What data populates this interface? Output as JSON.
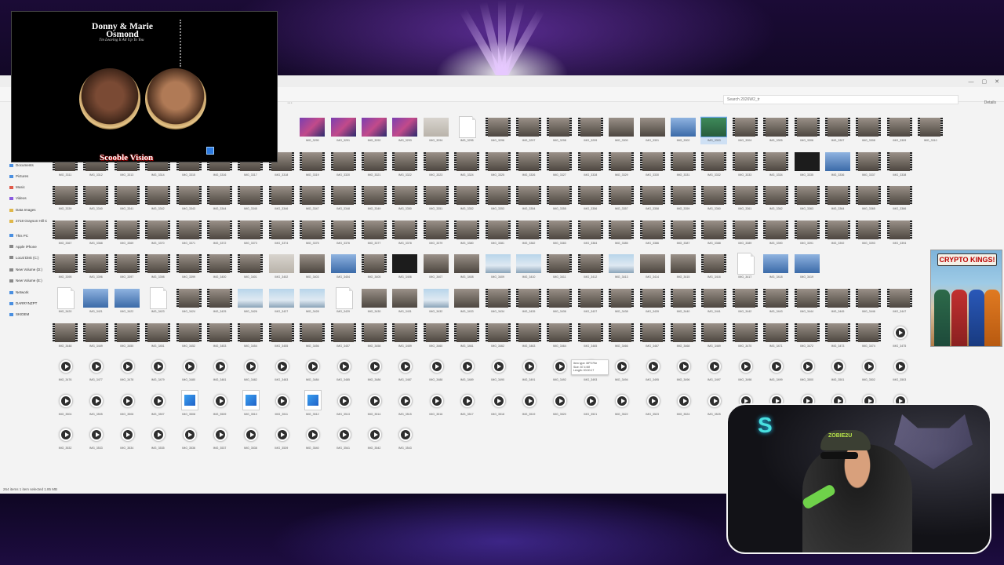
{
  "explorer": {
    "search_placeholder": "Search 2026W2_tr",
    "window_controls": [
      "—",
      "▢",
      "✕"
    ],
    "more_label": "···",
    "details_label": "Details",
    "status_text": "264 items    1 item selected  1.85 MB",
    "sidebar": [
      {
        "label": "Documents",
        "color": "#4a8fe0"
      },
      {
        "label": "Pictures",
        "color": "#4a8fe0"
      },
      {
        "label": "Music",
        "color": "#e05a4a"
      },
      {
        "label": "Videos",
        "color": "#8a5ae0"
      },
      {
        "label": "Data Images",
        "color": "#e0b84a"
      },
      {
        "label": "2718 Grayson Hill C",
        "color": "#e0b84a"
      },
      {
        "label": "This PC",
        "color": "#4a8fe0"
      },
      {
        "label": "Apple iPhone",
        "color": "#888888"
      },
      {
        "label": "Local Disk (C:)",
        "color": "#888888"
      },
      {
        "label": "New Volume (D:)",
        "color": "#888888"
      },
      {
        "label": "New Volume (E:)",
        "color": "#888888"
      },
      {
        "label": "Network",
        "color": "#4a8fe0"
      },
      {
        "label": "DARRYNZPT",
        "color": "#4a8fe0"
      },
      {
        "label": "SKIDEM",
        "color": "#4a8fe0"
      }
    ]
  },
  "tooltip": {
    "line1": "Item type: MP3 File",
    "line2": "Size: 87.4 MB",
    "line3": "Length: 00:00:17"
  },
  "grid": {
    "selected": "IMG_3303",
    "rows": [
      {
        "start": 8,
        "kinds": [
          "pc",
          "pc",
          "pc",
          "pc",
          "light",
          "doc",
          "film",
          "film",
          "film",
          "film",
          "room",
          "room",
          "blue",
          "green",
          "film",
          "film",
          "film",
          "film",
          "film",
          "film",
          "film"
        ]
      },
      {
        "start": 0,
        "kinds": [
          "film",
          "film",
          "film",
          "film",
          "film",
          "film",
          "film",
          "film",
          "film",
          "film",
          "film",
          "film",
          "film",
          "film",
          "film",
          "film",
          "film",
          "film",
          "film",
          "film",
          "film",
          "film",
          "film",
          "film",
          "dark",
          "blue",
          "film",
          "film"
        ]
      },
      {
        "start": 0,
        "kinds": [
          "film",
          "film",
          "film",
          "film",
          "film",
          "film",
          "film",
          "film",
          "film",
          "film",
          "film",
          "film",
          "film",
          "film",
          "film",
          "film",
          "film",
          "film",
          "film",
          "film",
          "film",
          "film",
          "film",
          "film",
          "film",
          "film",
          "film",
          "film"
        ]
      },
      {
        "start": 0,
        "kinds": [
          "film",
          "film",
          "film",
          "film",
          "film",
          "film",
          "film",
          "film",
          "film",
          "film",
          "film",
          "film",
          "film",
          "film",
          "film",
          "film",
          "film",
          "film",
          "film",
          "film",
          "film",
          "film",
          "film",
          "film",
          "film",
          "film",
          "film",
          "film"
        ]
      },
      {
        "start": 0,
        "kinds": [
          "film",
          "film",
          "film",
          "film",
          "film",
          "film",
          "film",
          "light",
          "room",
          "blue",
          "film",
          "dark",
          "room",
          "room",
          "sky",
          "sky",
          "film",
          "film",
          "sky",
          "room",
          "room",
          "film",
          "doc",
          "blue",
          "blue"
        ]
      },
      {
        "start": 0,
        "kinds": [
          "doc",
          "blue",
          "blue",
          "doc",
          "film",
          "film",
          "sky",
          "sky",
          "sky",
          "doc",
          "room",
          "room",
          "sky",
          "room",
          "film",
          "film",
          "film",
          "film",
          "film",
          "film",
          "film",
          "film",
          "film",
          "film",
          "film",
          "film",
          "film",
          "film"
        ]
      },
      {
        "start": 0,
        "kinds": [
          "film",
          "film",
          "film",
          "film",
          "film",
          "film",
          "film",
          "film",
          "film",
          "film",
          "film",
          "film",
          "film",
          "film",
          "film",
          "film",
          "film",
          "film",
          "film",
          "film",
          "film",
          "film",
          "film",
          "film",
          "film",
          "film",
          "film",
          "audio"
        ]
      },
      {
        "start": 0,
        "kinds": [
          "audio",
          "audio",
          "audio",
          "audio",
          "audio",
          "audio",
          "audio",
          "audio",
          "audio",
          "audio",
          "audio",
          "audio",
          "audio",
          "audio",
          "audio",
          "audio",
          "audio",
          "audio",
          "audio",
          "audio",
          "audio",
          "audio",
          "audio",
          "audio",
          "audio",
          "audio",
          "audio",
          "audio"
        ]
      },
      {
        "start": 0,
        "kinds": [
          "audio",
          "audio",
          "audio",
          "audio",
          "photoapp",
          "audio",
          "photoapp",
          "audio",
          "photoapp",
          "audio",
          "audio",
          "audio",
          "audio",
          "audio",
          "audio",
          "audio",
          "audio",
          "audio",
          "audio",
          "audio",
          "audio",
          "audio",
          "audio",
          "audio",
          "audio",
          "audio",
          "audio",
          "audio"
        ]
      },
      {
        "start": 0,
        "kinds": [
          "audio",
          "audio",
          "audio",
          "audio",
          "audio",
          "audio",
          "audio",
          "audio",
          "audio",
          "audio",
          "audio",
          "audio"
        ]
      }
    ]
  },
  "album": {
    "artist": "Donny & Marie Osmond",
    "title": "I'm Leaving It All Up To You",
    "brand": "Scooble Vision"
  },
  "crypto": {
    "sign": "CRYPTO KINGS!"
  },
  "webcam": {
    "hat_text": "ZOBIE2U",
    "logo": "S"
  }
}
